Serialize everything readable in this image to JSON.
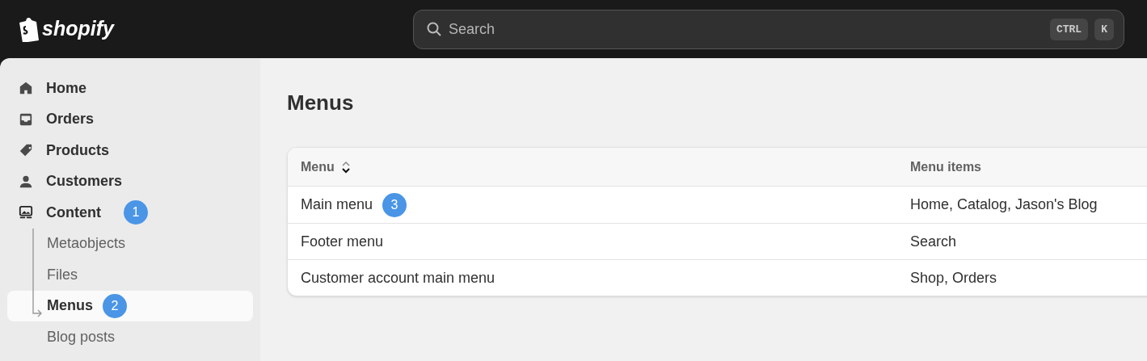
{
  "header": {
    "logo": "shopify",
    "search": {
      "placeholder": "Search",
      "shortcut": [
        "CTRL",
        "K"
      ]
    }
  },
  "sidebar": {
    "items": [
      {
        "label": "Home",
        "selected": false
      },
      {
        "label": "Orders",
        "selected": false
      },
      {
        "label": "Products",
        "selected": false
      },
      {
        "label": "Customers",
        "selected": false
      },
      {
        "label": "Content",
        "selected": false,
        "badge": "1",
        "expanded": true,
        "children": [
          {
            "label": "Metaobjects",
            "selected": false
          },
          {
            "label": "Files",
            "selected": false
          },
          {
            "label": "Menus",
            "selected": true,
            "badge": "2"
          },
          {
            "label": "Blog posts",
            "selected": false
          }
        ]
      }
    ]
  },
  "page": {
    "title": "Menus"
  },
  "table": {
    "columns": [
      "Menu",
      "Menu items"
    ],
    "rows": [
      {
        "cells": [
          "Main menu",
          "Home, Catalog, Jason's Blog"
        ],
        "badge": "3"
      },
      {
        "cells": [
          "Footer menu",
          "Search"
        ]
      },
      {
        "cells": [
          "Customer account main menu",
          "Shop, Orders"
        ]
      }
    ]
  }
}
